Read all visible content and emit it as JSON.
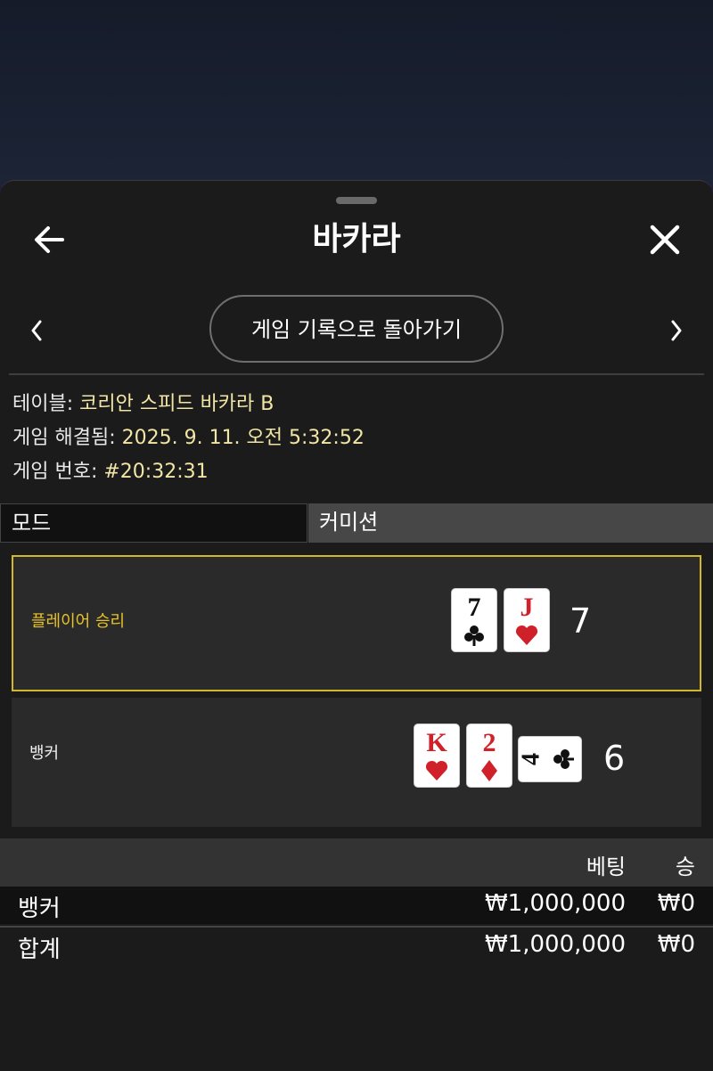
{
  "header": {
    "title": "바카라"
  },
  "nav": {
    "back_to_history": "게임 기록으로 돌아가기"
  },
  "info": {
    "table_label": "테이블: ",
    "table_value": "코리안 스피드 바카라 B",
    "resolved_label": "게임 해결됨: ",
    "resolved_value": "2025. 9. 11. 오전 5:32:52",
    "game_no_label": "게임 번호: ",
    "game_no_value": "#20:32:31"
  },
  "tabs": {
    "mode": "모드",
    "commission": "커미션"
  },
  "outcomes": {
    "player": {
      "label": "플레이어 승리",
      "score": "7",
      "cards": [
        {
          "rank": "7",
          "suit": "club"
        },
        {
          "rank": "J",
          "suit": "heart"
        }
      ]
    },
    "banker": {
      "label": "뱅커",
      "score": "6",
      "cards": [
        {
          "rank": "K",
          "suit": "heart"
        },
        {
          "rank": "2",
          "suit": "diamond"
        },
        {
          "rank": "4",
          "suit": "club"
        }
      ]
    }
  },
  "bets_table": {
    "headers": {
      "bet": "베팅",
      "win": "승"
    },
    "rows": [
      {
        "name": "뱅커",
        "bet": "₩1,000,000",
        "win": "₩0"
      },
      {
        "name": "합계",
        "bet": "₩1,000,000",
        "win": "₩0"
      }
    ]
  },
  "colors": {
    "accent_gold": "#d4b62a",
    "value_text": "#f1e6a6",
    "red_suit": "#d0202a"
  }
}
